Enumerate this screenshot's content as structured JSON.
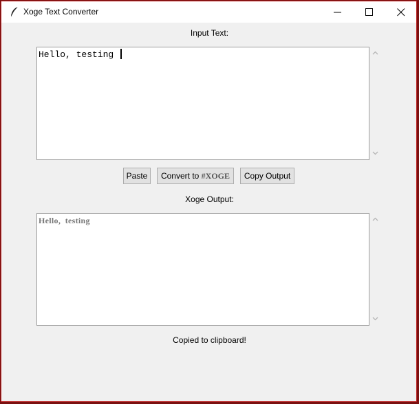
{
  "window": {
    "title": "Xoge Text Converter"
  },
  "input": {
    "label": "Input Text:",
    "value": "Hello, testing "
  },
  "buttons": {
    "paste": "Paste",
    "convert_prefix": "Convert to ",
    "convert_mark": "#XOGE",
    "copy": "Copy Output"
  },
  "output": {
    "label": "Xoge Output:",
    "value": "Hello,  testing"
  },
  "status": {
    "message": "Copied to clipboard!"
  },
  "icons": {
    "app": "feather-icon",
    "minimize": "minimize-icon",
    "maximize": "maximize-icon",
    "close": "close-icon"
  }
}
